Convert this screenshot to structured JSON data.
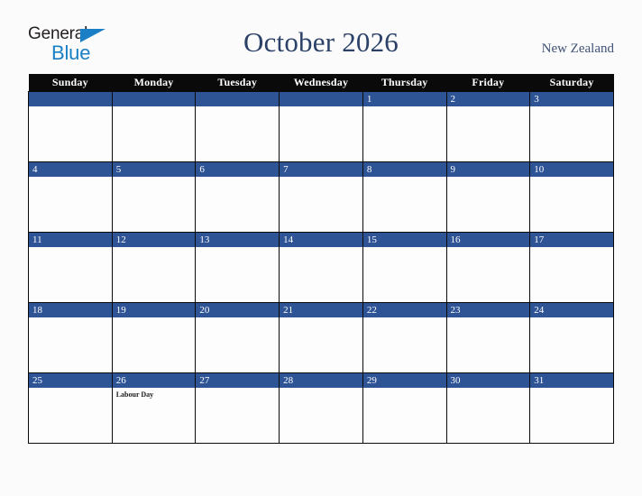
{
  "brand": {
    "name_part1": "General",
    "name_part2": "Blue",
    "triangle_icon": "triangle-icon",
    "color_dark": "#231f20",
    "color_blue": "#1a7fc4"
  },
  "header": {
    "title": "October 2026",
    "country": "New Zealand",
    "title_color": "#2b4168"
  },
  "calendar": {
    "month": "October",
    "year": "2026",
    "colors": {
      "header_bar": "#0a0a0a",
      "day_bar": "#2e5496",
      "cell_bg": "#fdfdfd",
      "page_bg": "#fbfbfb"
    },
    "weekdays": [
      "Sunday",
      "Monday",
      "Tuesday",
      "Wednesday",
      "Thursday",
      "Friday",
      "Saturday"
    ],
    "weeks": [
      [
        {
          "date": "",
          "events": []
        },
        {
          "date": "",
          "events": []
        },
        {
          "date": "",
          "events": []
        },
        {
          "date": "",
          "events": []
        },
        {
          "date": "1",
          "events": []
        },
        {
          "date": "2",
          "events": []
        },
        {
          "date": "3",
          "events": []
        }
      ],
      [
        {
          "date": "4",
          "events": []
        },
        {
          "date": "5",
          "events": []
        },
        {
          "date": "6",
          "events": []
        },
        {
          "date": "7",
          "events": []
        },
        {
          "date": "8",
          "events": []
        },
        {
          "date": "9",
          "events": []
        },
        {
          "date": "10",
          "events": []
        }
      ],
      [
        {
          "date": "11",
          "events": []
        },
        {
          "date": "12",
          "events": []
        },
        {
          "date": "13",
          "events": []
        },
        {
          "date": "14",
          "events": []
        },
        {
          "date": "15",
          "events": []
        },
        {
          "date": "16",
          "events": []
        },
        {
          "date": "17",
          "events": []
        }
      ],
      [
        {
          "date": "18",
          "events": []
        },
        {
          "date": "19",
          "events": []
        },
        {
          "date": "20",
          "events": []
        },
        {
          "date": "21",
          "events": []
        },
        {
          "date": "22",
          "events": []
        },
        {
          "date": "23",
          "events": []
        },
        {
          "date": "24",
          "events": []
        }
      ],
      [
        {
          "date": "25",
          "events": []
        },
        {
          "date": "26",
          "events": [
            "Labour Day"
          ]
        },
        {
          "date": "27",
          "events": []
        },
        {
          "date": "28",
          "events": []
        },
        {
          "date": "29",
          "events": []
        },
        {
          "date": "30",
          "events": []
        },
        {
          "date": "31",
          "events": []
        }
      ]
    ]
  }
}
